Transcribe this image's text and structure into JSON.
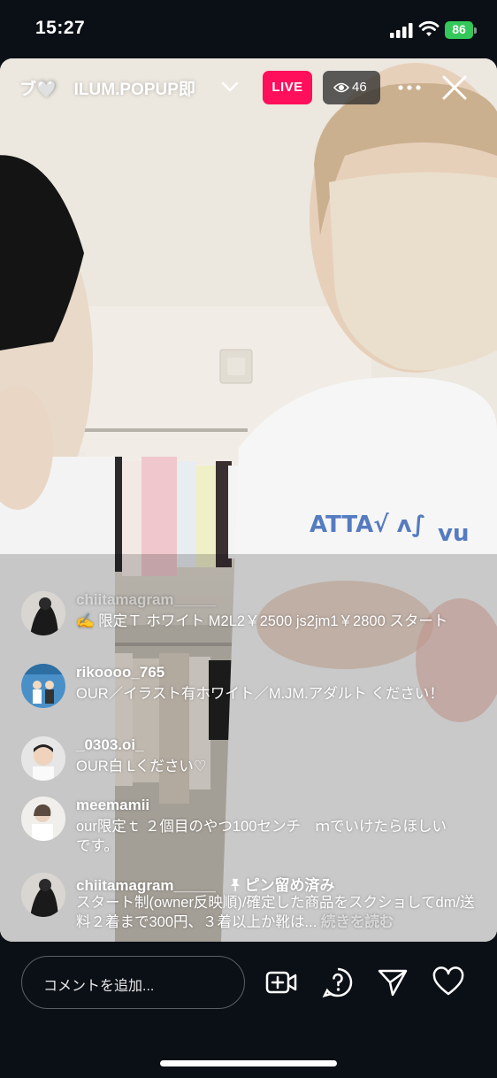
{
  "status_bar": {
    "time": "15:27",
    "battery": "86"
  },
  "header": {
    "title": "ブ🤍　ILUM.POPUP即",
    "live_label": "LIVE",
    "viewer_count": "46"
  },
  "comments": [
    {
      "user": "chiitamagram_____",
      "text": "✍️ 限定Ｔ ホワイト M2L2￥2500 js2jm1￥2800 スタート"
    },
    {
      "user": "rikoooo_765",
      "text": "OUR／イラスト有ホワイト／M.JM.アダルト ください！"
    },
    {
      "user": "_0303.oi_",
      "text": "OUR白 Lください♡"
    },
    {
      "user": "meemamii",
      "text": "our限定ｔ ２個目のやつ100センチ　ｍでいけたらほしいです。"
    },
    {
      "user": "chiitamagram_____",
      "pinned_label": "ピン留め済み",
      "text": "スタート制(owner反映順)/確定した商品をスクショしてdm/送料２着まで300円、３着以上か靴は...",
      "read_more": "続きを読む"
    }
  ],
  "footer": {
    "comment_placeholder": "コメントを追加..."
  },
  "icons": {
    "signal": "cellular-signal-icon",
    "wifi": "wifi-icon",
    "battery": "battery-icon",
    "chevron": "chevron-down-icon",
    "eye": "eye-icon",
    "more": "more-icon",
    "close": "close-icon",
    "pin": "pin-icon",
    "add_video": "add-video-icon",
    "question": "question-icon",
    "send": "send-icon",
    "heart": "heart-icon"
  },
  "colors": {
    "live": "#ff0f5c",
    "battery": "#34c759",
    "background": "#0b1016"
  }
}
